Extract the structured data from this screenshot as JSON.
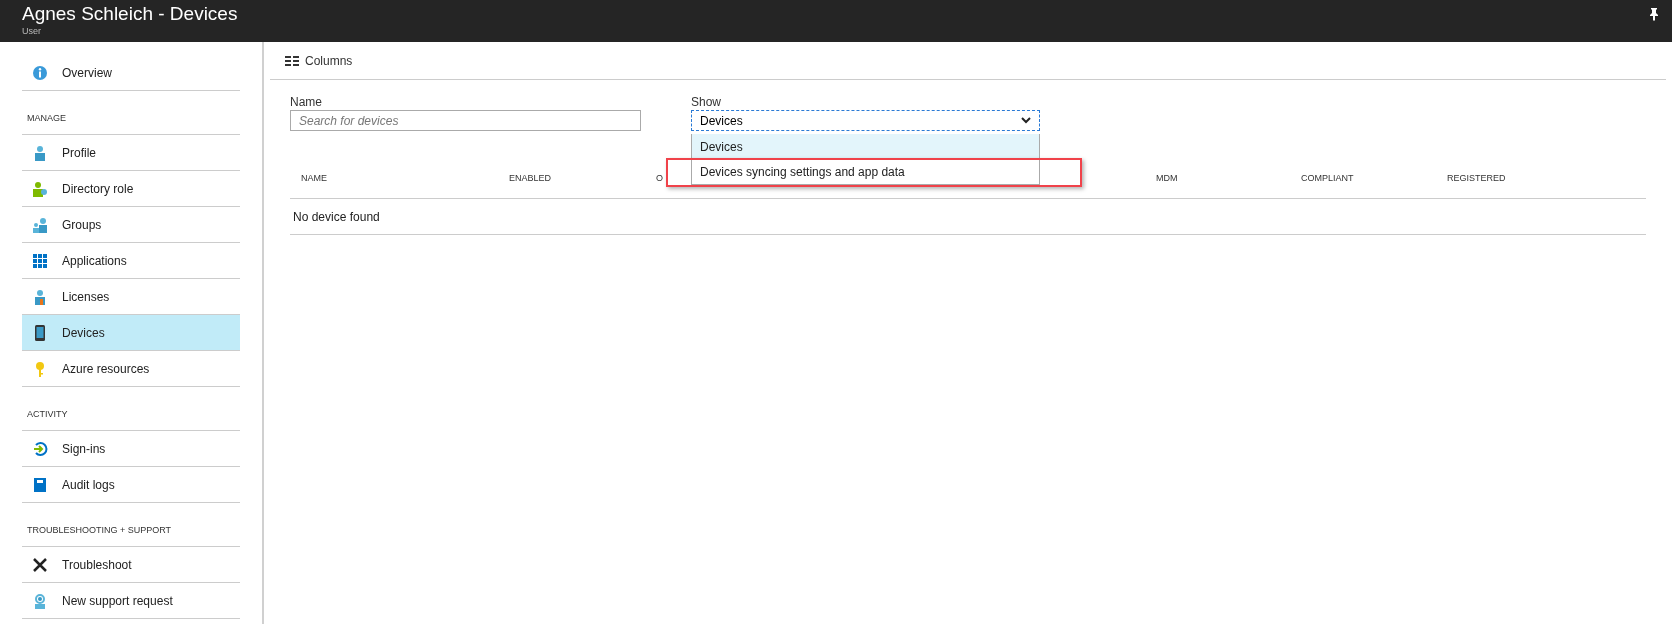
{
  "window": {
    "title": "Agnes Schleich - Devices",
    "subtitle": "User"
  },
  "sidebar": {
    "sections": [
      {
        "items": [
          {
            "label": "Overview",
            "selected": false
          }
        ]
      },
      {
        "heading": "MANAGE",
        "items": [
          {
            "label": "Profile",
            "selected": false
          },
          {
            "label": "Directory role",
            "selected": false
          },
          {
            "label": "Groups",
            "selected": false
          },
          {
            "label": "Applications",
            "selected": false
          },
          {
            "label": "Licenses",
            "selected": false
          },
          {
            "label": "Devices",
            "selected": true
          },
          {
            "label": "Azure resources",
            "selected": false
          }
        ]
      },
      {
        "heading": "ACTIVITY",
        "items": [
          {
            "label": "Sign-ins",
            "selected": false
          },
          {
            "label": "Audit logs",
            "selected": false
          }
        ]
      },
      {
        "heading": "TROUBLESHOOTING + SUPPORT",
        "items": [
          {
            "label": "Troubleshoot",
            "selected": false
          },
          {
            "label": "New support request",
            "selected": false
          }
        ]
      }
    ]
  },
  "toolbar": {
    "columns_button": "Columns"
  },
  "filters": {
    "name": {
      "label": "Name",
      "placeholder": "Search for devices"
    },
    "show": {
      "label": "Show",
      "value": "Devices",
      "expanded": true,
      "options": [
        {
          "label": "Devices",
          "selected": true,
          "highlighted": false
        },
        {
          "label": "Devices syncing settings and app data",
          "selected": false,
          "highlighted": true
        }
      ]
    }
  },
  "table": {
    "columns": [
      "NAME",
      "ENABLED",
      "O",
      "MDM",
      "COMPLIANT",
      "REGISTERED"
    ],
    "empty_message": "No device found"
  }
}
